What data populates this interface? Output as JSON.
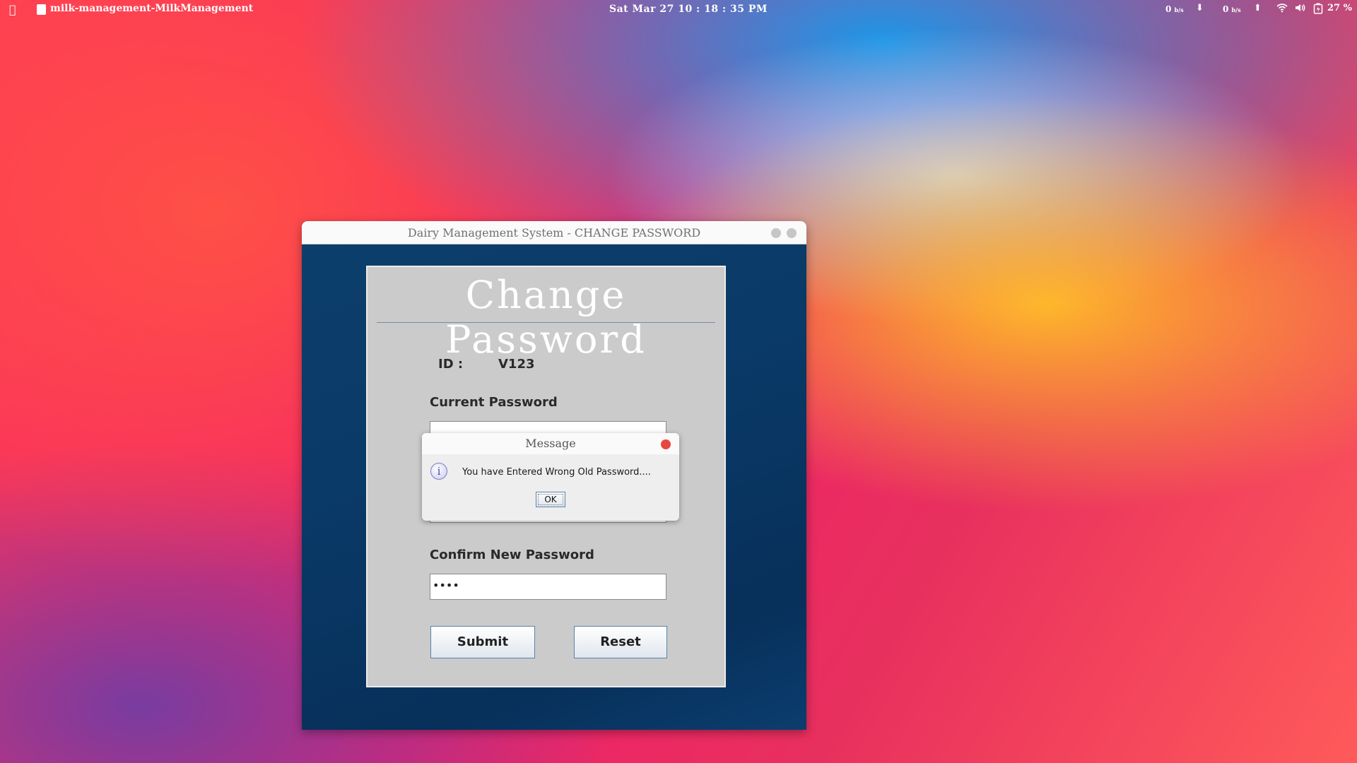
{
  "menubar": {
    "app_title": "milk-management-MilkManagement",
    "clock": "Sat Mar 27  10 : 18 : 35 PM",
    "net_down_value": "0",
    "net_down_unit": "b/s",
    "net_up_value": "0",
    "net_up_unit": "b/s",
    "battery": "27 %",
    "icons": [
      "apple-icon",
      "java-app-icon",
      "download-arrow-icon",
      "upload-arrow-icon",
      "wifi-icon",
      "volume-icon",
      "battery-icon"
    ]
  },
  "window": {
    "title": "Dairy Management System - CHANGE PASSWORD",
    "heading": "Change  Password",
    "id_label": "ID :",
    "id_value": "V123",
    "current_password_label": "Current Password",
    "current_password_value": "",
    "new_password_value": "",
    "confirm_new_password_label": "Confirm New Password",
    "confirm_new_password_value": "••••",
    "submit_label": "Submit",
    "reset_label": "Reset"
  },
  "dialog": {
    "title": "Message",
    "message": "You have Entered Wrong Old Password....",
    "ok_label": "OK",
    "info_glyph": "i"
  },
  "colors": {
    "window_bg": "#0a3a68",
    "panel_bg": "#cbcbcb",
    "close_red": "#e8473f",
    "button_border": "#5a82a8"
  }
}
